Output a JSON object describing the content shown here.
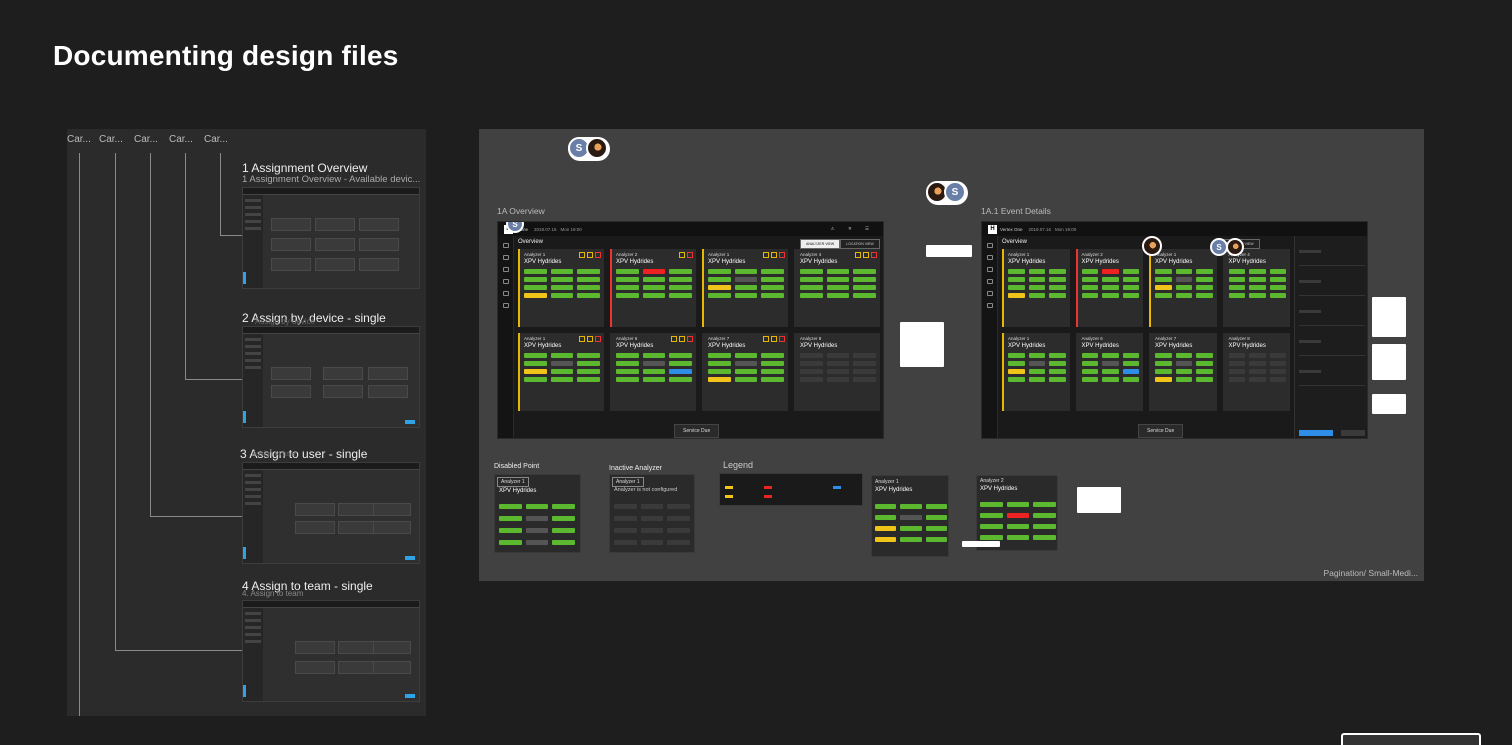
{
  "page_title": "Documenting design files",
  "flow": {
    "card_stubs": [
      "Car...",
      "Car...",
      "Car...",
      "Car...",
      "Car..."
    ],
    "steps": [
      {
        "title": "1 Assignment Overview",
        "sub": "1 Assignment Overview - Available devic..."
      },
      {
        "title": "2 Assign by. device - single",
        "sub": "Assign by device"
      },
      {
        "title": "3 Assign to user - single",
        "sub": "Assign to user"
      },
      {
        "title": "4 Assign to team - single",
        "sub": "4. Assign to team"
      }
    ]
  },
  "board": {
    "frames": {
      "overview": "1A Overview",
      "event_details": "1A.1 Event Details"
    },
    "avatar_letter": "S",
    "app": {
      "brand": "Vertex One",
      "brand_short": "x One",
      "date": "2019.07.16",
      "time": "Mon 19:00",
      "section": "Overview",
      "tabs": [
        "ANALYZER VIEW",
        "LOCATION VIEW"
      ],
      "service_due": "Service Due"
    },
    "analyzers": [
      {
        "id": "Analyzer 1",
        "name": "XPV Hydrides"
      },
      {
        "id": "Analyzer 2",
        "name": "XPV Hydrides"
      },
      {
        "id": "Analyzer 1",
        "name": "XPV Hydrides"
      },
      {
        "id": "Analyzer 4",
        "name": "XPV Hydrides"
      },
      {
        "id": "Analyzer 1",
        "name": "XPV Hydrides"
      },
      {
        "id": "Analyzer 6",
        "name": "XPV Hydrides"
      },
      {
        "id": "Analyzer 7",
        "name": "XPV Hydrides"
      },
      {
        "id": "Analyzer 8",
        "name": "XPV Hydrides"
      }
    ],
    "legend": {
      "title": "Legend",
      "disabled_point": "Disabled Point",
      "inactive_analyzer": "Inactive Analyzer",
      "inactive_text": "Analyzer is not configured",
      "analyzer_label": "Analyzer 1",
      "analyzer_name": "XPV Hydrides",
      "sample_1": {
        "id": "Analyzer 1",
        "name": "XPV Hydrides"
      },
      "sample_2": {
        "id": "Analyzer 2",
        "name": "XPV Hydrides"
      }
    },
    "pagination_label": "Pagination/ Small-Medi..."
  },
  "colors": {
    "background": "#1e1e1e",
    "panel": "#2b2b2b",
    "board": "#414141",
    "ok_green": "#5cb82e",
    "alarm_red": "#e22222",
    "warn_yellow": "#f0c419",
    "info_blue": "#2e8de6",
    "amber": "#e6b800"
  }
}
